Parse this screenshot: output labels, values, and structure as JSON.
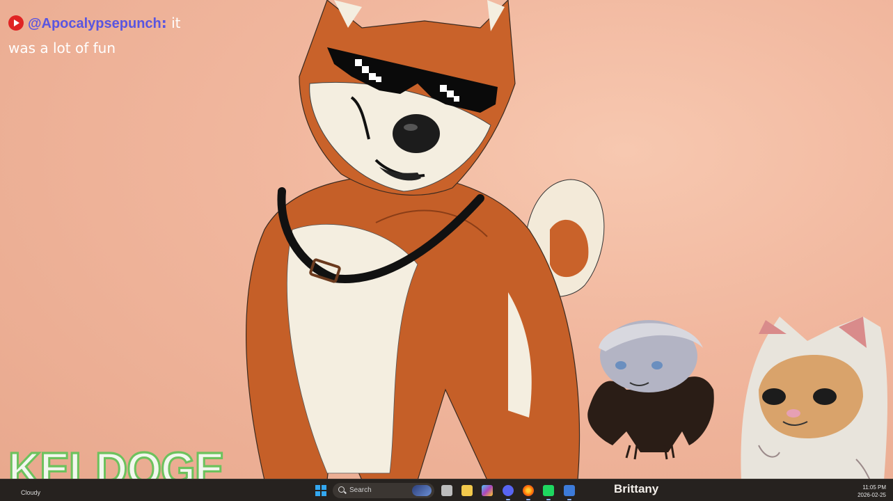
{
  "chat": {
    "username": "@Apocalypsepunch",
    "separator": ":",
    "message_line1": " it",
    "message_line2": "was a lot of fun"
  },
  "brand": {
    "logo_text": "KELDOGE"
  },
  "nameplate": "Brittany",
  "taskbar": {
    "weather": "Cloudy",
    "search_label": "Search",
    "time": "11:05 PM",
    "date": "2026-02-25",
    "apps": [
      "file-explorer-icon",
      "copilot-icon",
      "discord-icon",
      "firefox-icon",
      "spotify-icon",
      "app-icon"
    ]
  },
  "colors": {
    "username": "#5a55e0",
    "background": "#f1b79e",
    "dog_fur": "#c9622a",
    "logo_outline": "#6dc25d"
  }
}
